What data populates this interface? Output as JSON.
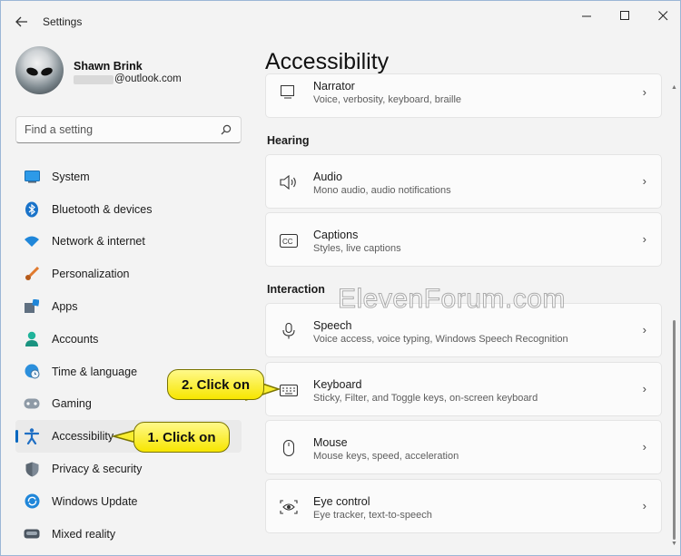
{
  "window": {
    "title": "Settings"
  },
  "user": {
    "name": "Shawn Brink",
    "email": "@outlook.com"
  },
  "search": {
    "placeholder": "Find a setting"
  },
  "sidebar": {
    "items": [
      {
        "label": "System",
        "icon": "system-icon"
      },
      {
        "label": "Bluetooth & devices",
        "icon": "bluetooth-icon"
      },
      {
        "label": "Network & internet",
        "icon": "wifi-icon"
      },
      {
        "label": "Personalization",
        "icon": "brush-icon"
      },
      {
        "label": "Apps",
        "icon": "apps-icon"
      },
      {
        "label": "Accounts",
        "icon": "person-icon"
      },
      {
        "label": "Time & language",
        "icon": "globe-clock-icon"
      },
      {
        "label": "Gaming",
        "icon": "gamepad-icon"
      },
      {
        "label": "Accessibility",
        "icon": "accessibility-icon",
        "selected": true
      },
      {
        "label": "Privacy & security",
        "icon": "shield-icon"
      },
      {
        "label": "Windows Update",
        "icon": "update-icon"
      },
      {
        "label": "Mixed reality",
        "icon": "vr-headset-icon"
      }
    ]
  },
  "main": {
    "title": "Accessibility",
    "narrator": {
      "title": "Narrator",
      "desc": "Voice, verbosity, keyboard, braille"
    },
    "hearing": {
      "heading": "Hearing",
      "items": [
        {
          "title": "Audio",
          "desc": "Mono audio, audio notifications",
          "icon": "speaker-icon"
        },
        {
          "title": "Captions",
          "desc": "Styles, live captions",
          "icon": "cc-icon"
        }
      ]
    },
    "interaction": {
      "heading": "Interaction",
      "items": [
        {
          "title": "Speech",
          "desc": "Voice access, voice typing, Windows Speech Recognition",
          "icon": "microphone-icon"
        },
        {
          "title": "Keyboard",
          "desc": "Sticky, Filter, and Toggle keys, on-screen keyboard",
          "icon": "keyboard-icon"
        },
        {
          "title": "Mouse",
          "desc": "Mouse keys, speed, acceleration",
          "icon": "mouse-icon"
        },
        {
          "title": "Eye control",
          "desc": "Eye tracker, text-to-speech",
          "icon": "eye-icon"
        }
      ]
    }
  },
  "callouts": {
    "step1": "1. Click on",
    "step2": "2. Click on"
  },
  "watermark": "ElevenForum.com",
  "colors": {
    "accent": "#0067c0",
    "callout": "#f7e600"
  }
}
